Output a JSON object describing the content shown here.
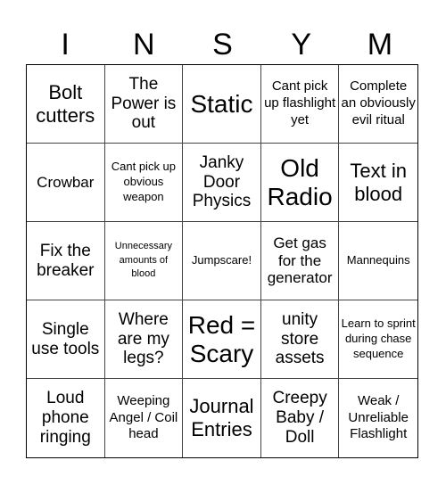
{
  "header": {
    "letters": [
      "I",
      "N",
      "S",
      "Y",
      "M"
    ]
  },
  "board": {
    "cells": [
      "Bolt cutters",
      "The Power is out",
      "Static",
      "Cant pick up flashlight yet",
      "Complete an obviously evil ritual",
      "Crowbar",
      "Cant pick up obvious weapon",
      "Janky Door Physics",
      "Old Radio",
      "Text in blood",
      "Fix the breaker",
      "Unnecessary amounts of blood",
      "Jumpscare!",
      "Get gas for the generator",
      "Mannequins",
      "Single use tools",
      "Where are my legs?",
      "Red = Scary",
      "unity store assets",
      "Learn to sprint during chase sequence",
      "Loud phone ringing",
      "Weeping Angel / Coil head",
      "Journal Entries",
      "Creepy Baby / Doll",
      "Weak / Unreliable Flashlight"
    ]
  }
}
